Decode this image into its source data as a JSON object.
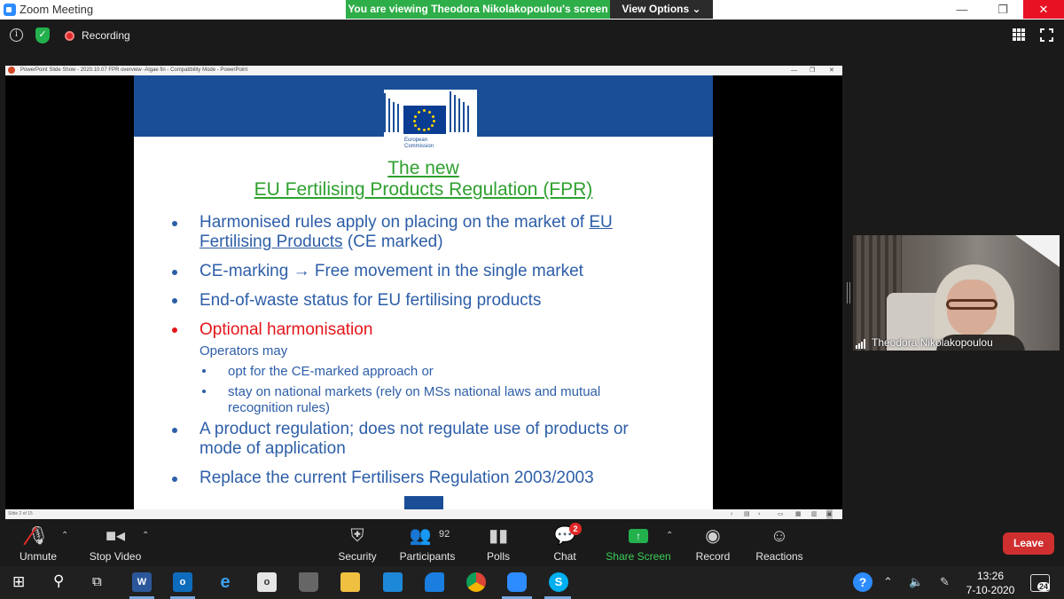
{
  "zoom": {
    "window_title": "Zoom Meeting",
    "viewing_banner": "You are viewing Theodora Nikolakopoulou's screen",
    "view_options": "View Options",
    "view_options_caret": "⌄",
    "recording_label": "Recording",
    "win_controls": {
      "minimize": "—",
      "restore": "❐",
      "close": "✕"
    }
  },
  "powerpoint": {
    "title": "PowerPoint Slide Show  -  2020.10.07 FPR overview -Algae fin  -  Compatibility Mode  -  PowerPoint",
    "status": "Slide 2 of 15",
    "win_controls": {
      "minimize": "—",
      "restore": "❐",
      "close": "✕"
    }
  },
  "slide": {
    "logo_text_line1": "European",
    "logo_text_line2": "Commission",
    "title_line1": "The new",
    "title_line2": "EU Fertilising Products Regulation (FPR)",
    "bullets": [
      {
        "text_a": "Harmonised rules apply on placing on the market of ",
        "link_a": "EU",
        "link_b": "Fertilising Products",
        "text_b": " (CE marked)"
      },
      {
        "text": "CE-marking → Free movement in the single market"
      },
      {
        "text": "End-of-waste status for EU fertilising products"
      },
      {
        "text": "Optional harmonisation"
      },
      {
        "text_line1": "A product regulation; does not regulate use of products or",
        "text_line2": "mode of application"
      },
      {
        "text": "Replace the current Fertilisers Regulation 2003/2003"
      }
    ],
    "operators_may": "Operators may",
    "sub_bullets": [
      {
        "text": "opt for the CE-marked approach or"
      },
      {
        "text_line1": "stay on national markets (rely on MSs national laws and mutual",
        "text_line2": "recognition rules)"
      }
    ]
  },
  "video": {
    "participant_name": "Theodora Nikolakopoulou"
  },
  "controls": {
    "unmute": "Unmute",
    "stop_video": "Stop Video",
    "security": "Security",
    "participants": "Participants",
    "participants_count": "92",
    "polls": "Polls",
    "chat": "Chat",
    "chat_badge": "2",
    "share_screen": "Share Screen",
    "record": "Record",
    "reactions": "Reactions",
    "leave": "Leave"
  },
  "taskbar": {
    "time": "13:26",
    "date": "7-10-2020",
    "notifications": "24",
    "apps": [
      "W",
      "o",
      "e",
      "o",
      "S"
    ]
  },
  "colors": {
    "zoom_green": "#2eae49",
    "slide_blue": "#1a4e96",
    "slide_text_blue": "#2d5ea8",
    "title_green": "#2ea02e",
    "highlight_red": "#e3161b",
    "leave_red": "#d02f2f"
  }
}
